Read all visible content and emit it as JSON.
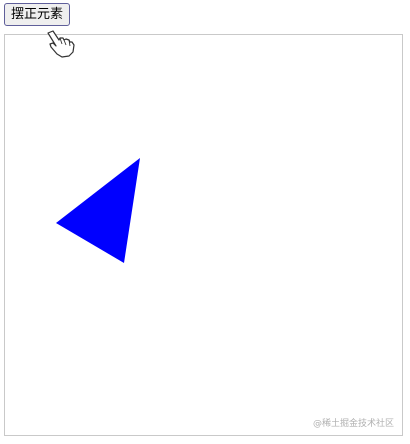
{
  "toolbar": {
    "straighten_label": "摆正元素"
  },
  "canvas": {
    "shape_color": "#0000ff",
    "border_color": "#c9c9c9",
    "watermark": "@稀土掘金技术社区"
  },
  "icons": {
    "cursor": "pointer-hand-icon",
    "shape": "triangle"
  }
}
